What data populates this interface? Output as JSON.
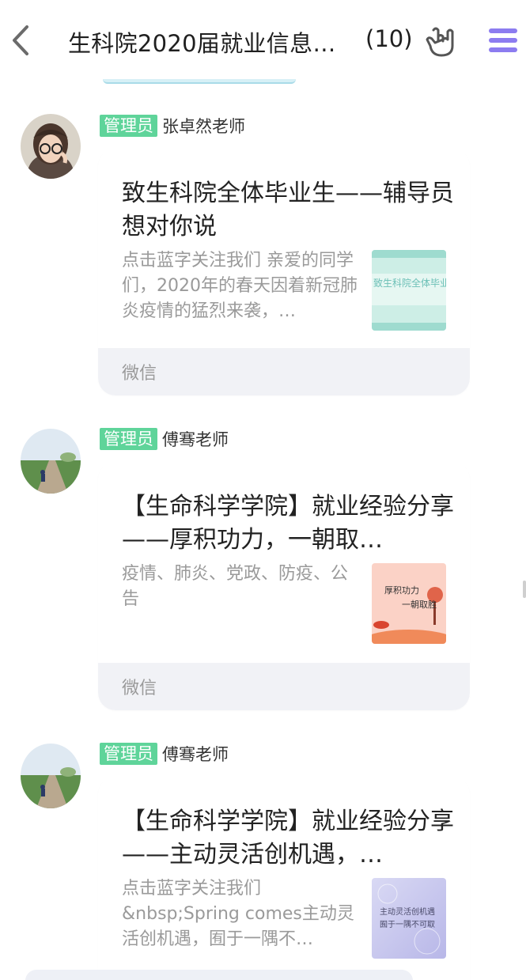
{
  "header": {
    "title": "生科院2020届就业信息…",
    "count": "(10)",
    "icons": {
      "back": "back-chevron-icon",
      "gesture": "rock-hand-icon",
      "menu": "menu-icon"
    },
    "menu_color": "#8c7cf0"
  },
  "messages": [
    {
      "badge": "管理员",
      "sender": "张卓然老师",
      "title": "致生科院全体毕业生——辅导员想对你说",
      "description": "点击蓝字关注我们 亲爱的同学们，2020年的春天因着新冠肺炎疫情的猛烈来袭，…",
      "thumbnail_text": "致生科院全体毕业生——辅导员想对…",
      "source": "微信"
    },
    {
      "badge": "管理员",
      "sender": "傅骞老师",
      "title": "【生命科学学院】就业经验分享——厚积功力，一朝取…",
      "description": "疫情、肺炎、党政、防疫、公告",
      "thumbnail_text": [
        "厚积功力",
        "一朝取胜"
      ],
      "source": "微信"
    },
    {
      "badge": "管理员",
      "sender": "傅骞老师",
      "title": "【生命科学学院】就业经验分享——主动灵活创机遇，…",
      "description": "点击蓝字关注我们 &nbsp;Spring comes主动灵活创机遇，囿于一隅不…",
      "thumbnail_text": [
        "主动灵活创机遇",
        "囿于一隅不可取"
      ],
      "source": ""
    }
  ]
}
